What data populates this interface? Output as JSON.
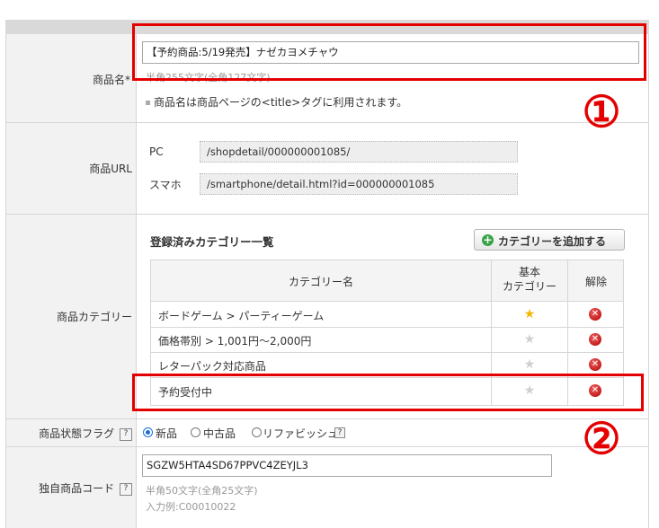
{
  "product_name": {
    "label": "商品名",
    "required_mark": "*",
    "value": "【予約商品:5/19発売】ナゼカヨメチャウ",
    "hint_limit": "半角255文字(全角127文字)",
    "note": "商品名は商品ページの<title>タグに利用されます。"
  },
  "product_url": {
    "label": "商品URL",
    "pc_label": "PC",
    "pc_value": "/shopdetail/000000001085/",
    "sp_label": "スマホ",
    "sp_value": "/smartphone/detail.html?id=000000001085"
  },
  "product_category": {
    "label": "商品カテゴリー",
    "section_title": "登録済みカテゴリー一覧",
    "add_button": "カテゴリーを追加する",
    "col_name": "カテゴリー名",
    "col_basic_line1": "基本",
    "col_basic_line2": "カテゴリー",
    "col_remove": "解除",
    "rows": [
      {
        "name": "ボードゲーム > パーティーゲーム",
        "is_basic": true
      },
      {
        "name": "価格帯別 > 1,001円〜2,000円",
        "is_basic": false
      },
      {
        "name": "レターパック対応商品",
        "is_basic": false
      },
      {
        "name": "予約受付中",
        "is_basic": false
      }
    ]
  },
  "status_flag": {
    "label": "商品状態フラグ",
    "help": "?",
    "options": [
      "新品",
      "中古品",
      "リファビッシュ"
    ],
    "selected": "新品"
  },
  "product_code": {
    "label": "独自商品コード",
    "help": "?",
    "value": "SGZW5HTA4SD67PPVC4ZEYJL3",
    "hint_limit": "半角50文字(全角25文字)",
    "hint_example": "入力例:C00010022"
  },
  "annotations": {
    "marker_1": "①",
    "marker_2": "②",
    "highlight_color": "#e40000"
  },
  "colors": {
    "label_bg": "#f2f2f2",
    "border": "#d6d6d6",
    "accent_green": "#3aa34a",
    "radio_blue": "#1a6fd6"
  }
}
